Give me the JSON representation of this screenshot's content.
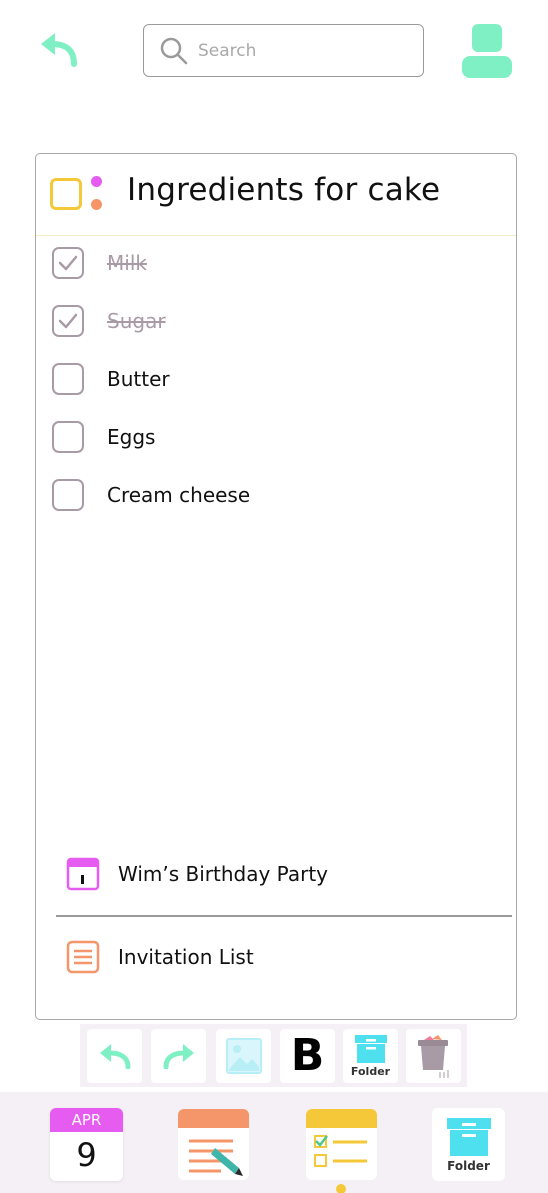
{
  "topbar": {
    "search_placeholder": "Search"
  },
  "note": {
    "title": "Ingredients for cake",
    "items": [
      {
        "label": "Milk",
        "checked": true
      },
      {
        "label": "Sugar",
        "checked": true
      },
      {
        "label": "Butter",
        "checked": false
      },
      {
        "label": "Eggs",
        "checked": false
      },
      {
        "label": "Cream cheese",
        "checked": false
      }
    ],
    "attachments": [
      {
        "label": "Wim’s Birthday Party",
        "icon": "calendar-icon"
      },
      {
        "label": "Invitation List",
        "icon": "list-doc-icon"
      }
    ]
  },
  "toolbar": {
    "folder_label": "Folder"
  },
  "dock": {
    "calendar_month": "APR",
    "calendar_day": "9",
    "folder_label": "Folder"
  },
  "colors": {
    "accent_green": "#7ef0c4",
    "accent_yellow": "#f5c83a",
    "accent_pink": "#e75cf0",
    "accent_orange": "#f4956a",
    "accent_cyan": "#4fe0f0",
    "checkbox_gray": "#a99ba6"
  }
}
